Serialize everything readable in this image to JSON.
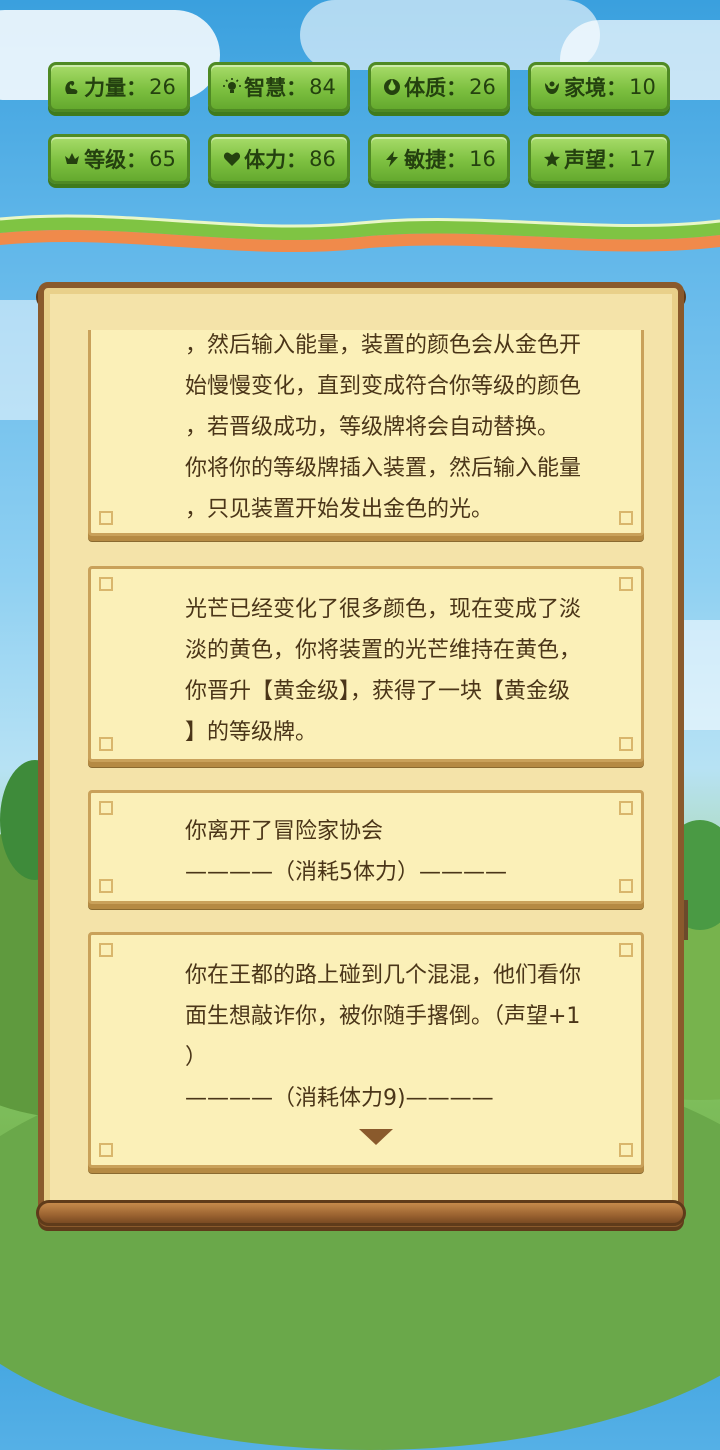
{
  "stats": [
    {
      "icon": "strength-icon",
      "glyph": "💪",
      "label": "力量",
      "value": "26"
    },
    {
      "icon": "wisdom-icon",
      "glyph": "💡",
      "label": "智慧",
      "value": "84"
    },
    {
      "icon": "constitution-icon",
      "glyph": "✪",
      "label": "体质",
      "value": "26"
    },
    {
      "icon": "family-icon",
      "glyph": "☯",
      "label": "家境",
      "value": "10"
    },
    {
      "icon": "crown-icon",
      "glyph": "♛",
      "label": "等级",
      "value": "65"
    },
    {
      "icon": "heart-icon",
      "glyph": "♥",
      "label": "体力",
      "value": "86"
    },
    {
      "icon": "lightning-icon",
      "glyph": "⚡",
      "label": "敏捷",
      "value": "16"
    },
    {
      "icon": "star-icon",
      "glyph": "★",
      "label": "声望",
      "value": "17"
    }
  ],
  "stat_separator": "：",
  "log": {
    "cards": [
      {
        "lines": [
          "，然后输入能量，装置的颜色会从金色开",
          "始慢慢变化，直到变成符合你等级的颜色",
          "，若晋级成功，等级牌将会自动替换。",
          "你将你的等级牌插入装置，然后输入能量",
          "，只见装置开始发出金色的光。"
        ]
      },
      {
        "lines": [
          "光芒已经变化了很多颜色，现在变成了淡",
          "淡的黄色，你将装置的光芒维持在黄色，",
          "你晋升【黄金级】，获得了一块【黄金级",
          "】的等级牌。"
        ]
      },
      {
        "lines": [
          "你离开了冒险家协会",
          "————（消耗5体力）————"
        ]
      },
      {
        "lines": [
          "你在王都的路上碰到几个混混，他们看你",
          "面生想敲诈你，被你随手撂倒。（声望+1",
          "）",
          "————（消耗体力9)————"
        ]
      }
    ]
  }
}
